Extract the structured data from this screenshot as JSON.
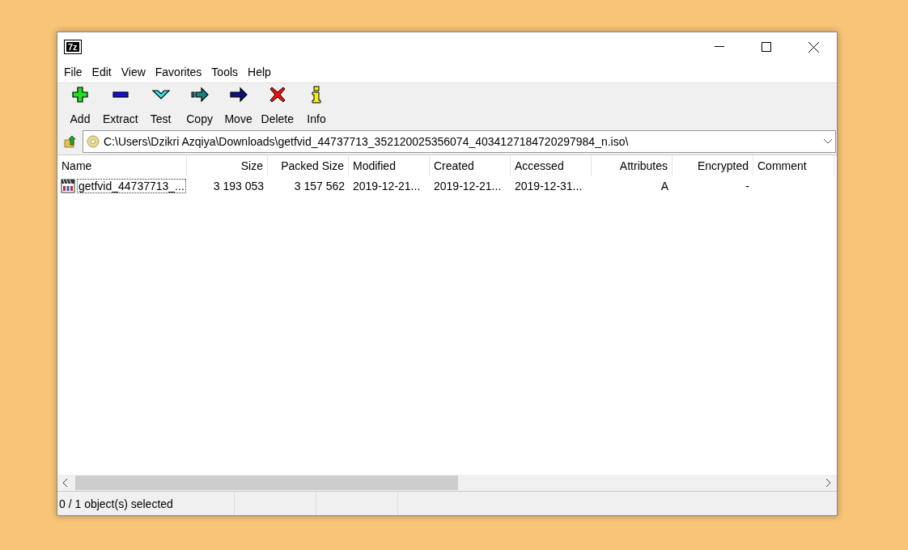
{
  "window": {
    "title": "7z"
  },
  "menu": [
    "File",
    "Edit",
    "View",
    "Favorites",
    "Tools",
    "Help"
  ],
  "toolbar": [
    {
      "label": "Add",
      "kind": "add"
    },
    {
      "label": "Extract",
      "kind": "extract"
    },
    {
      "label": "Test",
      "kind": "test"
    },
    {
      "label": "Copy",
      "kind": "copy"
    },
    {
      "label": "Move",
      "kind": "move"
    },
    {
      "label": "Delete",
      "kind": "delete"
    },
    {
      "label": "Info",
      "kind": "info"
    }
  ],
  "address": {
    "value": "C:\\Users\\Dzikri Azqiya\\Downloads\\getfvid_44737713_352120025356074_4034127184720297984_n.iso\\"
  },
  "table": {
    "columns": [
      {
        "label": "Name",
        "kind": "text"
      },
      {
        "label": "Size",
        "kind": "number"
      },
      {
        "label": "Packed Size",
        "kind": "number"
      },
      {
        "label": "Modified",
        "kind": "text"
      },
      {
        "label": "Created",
        "kind": "text"
      },
      {
        "label": "Accessed",
        "kind": "text"
      },
      {
        "label": "Attributes",
        "kind": "number"
      },
      {
        "label": "Encrypted",
        "kind": "number"
      },
      {
        "label": "Comment",
        "kind": "text"
      }
    ],
    "rows": [
      {
        "focused": true,
        "selected": false,
        "cells": [
          "getfvid_44737713_...",
          "3 193 053",
          "3 157 562",
          "2019-12-21...",
          "2019-12-21...",
          "2019-12-31...",
          "A",
          "-",
          ""
        ]
      }
    ]
  },
  "status_bar": [
    "0 / 1 object(s) selected"
  ]
}
